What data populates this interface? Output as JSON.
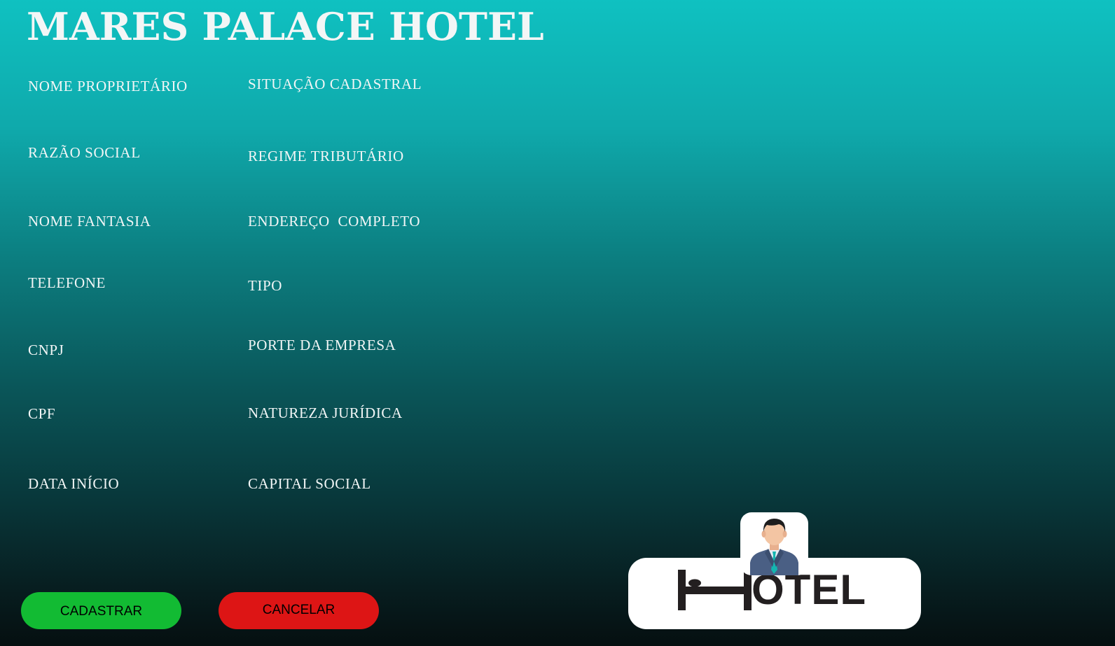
{
  "app": {
    "title": "MARES PALACE HOTEL"
  },
  "form": {
    "left_column": [
      "NOME PROPRIETÁRIO",
      "RAZÃO SOCIAL",
      "NOME FANTASIA",
      "TELEFONE",
      "CNPJ",
      "CPF",
      "DATA INÍCIO"
    ],
    "right_column": [
      "SITUAÇÃO CADASTRAL",
      "REGIME TRIBUTÁRIO",
      "ENDEREÇO  COMPLETO",
      "TIPO",
      "PORTE DA EMPRESA",
      "NATUREZA JURÍDICA",
      "CAPITAL SOCIAL"
    ]
  },
  "buttons": {
    "register": "CADASTRAR",
    "cancel": "CANCELAR"
  },
  "logo": {
    "text": "OTEL",
    "icons": [
      "bed-icon",
      "user-avatar-icon"
    ]
  },
  "colors": {
    "register_button": "#12bb33",
    "cancel_button": "#dd1515",
    "background_top": "#0fc1c1",
    "background_bottom": "#050f10"
  }
}
